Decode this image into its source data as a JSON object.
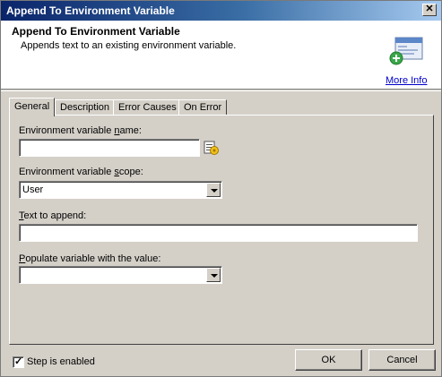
{
  "window": {
    "title": "Append To Environment Variable",
    "close_glyph": "✕"
  },
  "header": {
    "title": "Append To Environment Variable",
    "description": "Appends text to an existing environment variable.",
    "icon": "window-add-icon",
    "more_info": "More Info"
  },
  "tabs": [
    {
      "label": "General",
      "active": true
    },
    {
      "label": "Description",
      "active": false
    },
    {
      "label": "Error Causes",
      "active": false
    },
    {
      "label": "On Error",
      "active": false
    }
  ],
  "form": {
    "var_name": {
      "label_pre": "Environment variable ",
      "label_ul": "n",
      "label_post": "ame:",
      "value": ""
    },
    "var_scope": {
      "label_pre": "Environment variable ",
      "label_ul": "s",
      "label_post": "cope:",
      "value": "User"
    },
    "text_append": {
      "label_pre": "",
      "label_ul": "T",
      "label_post": "ext to append:",
      "value": ""
    },
    "populate": {
      "label_pre": "",
      "label_ul": "P",
      "label_post": "opulate variable with the value:",
      "value": ""
    }
  },
  "footer": {
    "step_enabled_label": "Step is enabled",
    "step_enabled_checked": true,
    "ok_label": "OK",
    "cancel_label": "Cancel"
  }
}
